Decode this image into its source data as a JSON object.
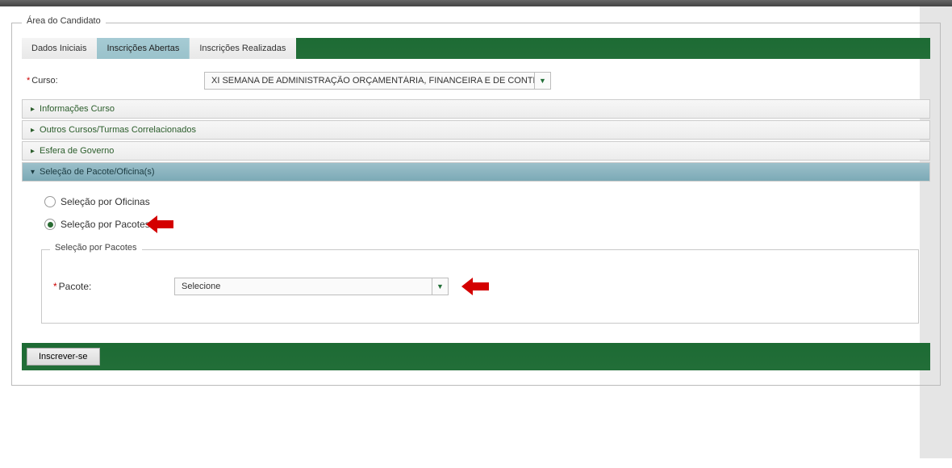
{
  "legend": "Área do Candidato",
  "tabs": {
    "dados": "Dados Iniciais",
    "abertas": "Inscrições Abertas",
    "realizadas": "Inscrições Realizadas"
  },
  "curso_label": "Curso:",
  "curso_value": "XI SEMANA DE ADMINISTRAÇÃO ORÇAMENTÁRIA, FINANCEIRA E DE CONTRATA",
  "accordion": {
    "info": "Informações Curso",
    "outros": "Outros Cursos/Turmas Correlacionados",
    "esfera": "Esfera de Governo",
    "selecao": "Seleção de Pacote/Oficina(s)"
  },
  "radios": {
    "oficinas": "Seleção por Oficinas",
    "pacotes": "Seleção por Pacotes"
  },
  "inner_legend": "Seleção por Pacotes",
  "pacote_label": "Pacote:",
  "pacote_placeholder": "Selecione",
  "submit": "Inscrever-se"
}
